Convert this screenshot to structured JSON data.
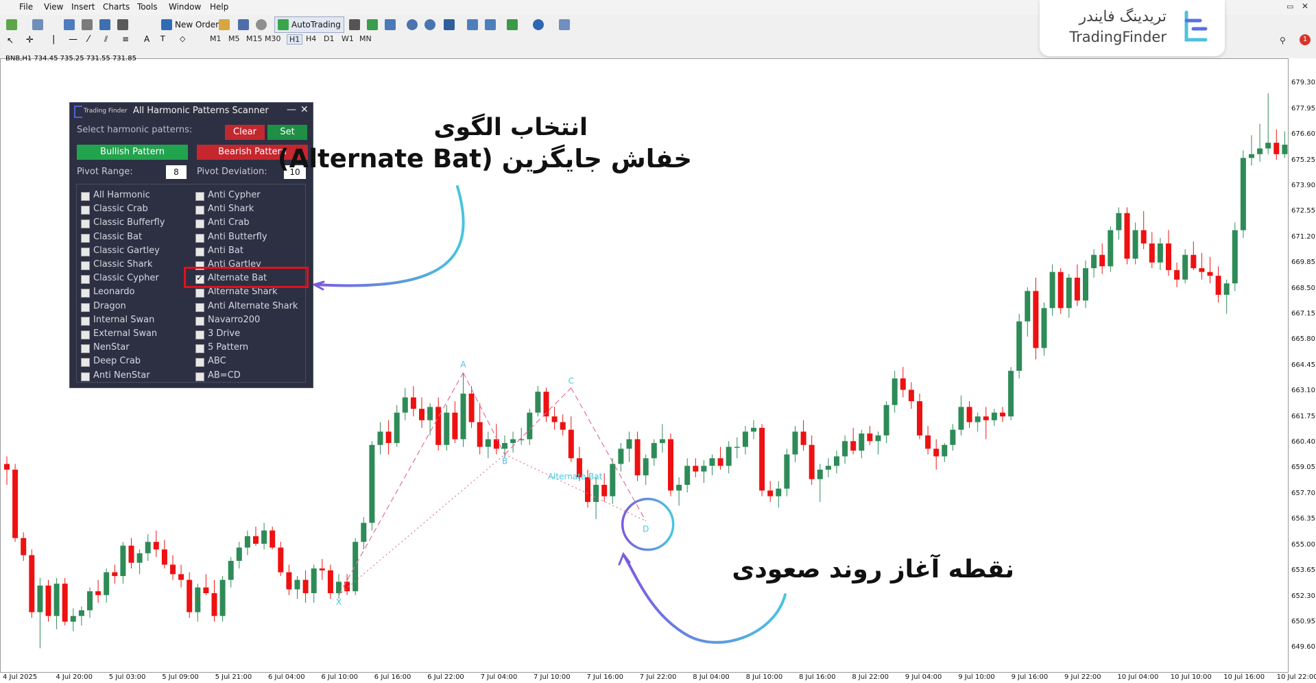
{
  "menu": [
    "File",
    "View",
    "Insert",
    "Charts",
    "Tools",
    "Window",
    "Help"
  ],
  "toolbar": {
    "new_order": "New Order",
    "autotrading": "AutoTrading"
  },
  "timeframes": [
    "M1",
    "M5",
    "M15",
    "M30",
    "H1",
    "H4",
    "D1",
    "W1",
    "MN"
  ],
  "logo": {
    "fa": "تریدینگ فایندر",
    "en": "TradingFinder"
  },
  "symbol_info": "BNB,H1  734.45 735.25 731.55 731.85",
  "panel": {
    "brand": "Trading Finder",
    "title": "All Harmonic Patterns Scanner",
    "minimize": "—",
    "close": "✕",
    "select_label": "Select harmonic patterns:",
    "clear": "Clear",
    "set": "Set",
    "bullish": "Bullish Pattern",
    "bearish": "Bearish Pattern",
    "pivot_range_label": "Pivot Range:",
    "pivot_range_value": "8",
    "pivot_deviation_label": "Pivot Deviation:",
    "pivot_deviation_value": "10",
    "left_items": [
      "All Harmonic",
      "Classic Crab",
      "Classic Bufferfly",
      "Classic Bat",
      "Classic Gartley",
      "Classic Shark",
      "Classic Cypher",
      "Leonardo",
      "Dragon",
      "Internal Swan",
      "External Swan",
      "NenStar",
      "Deep Crab",
      "Anti NenStar"
    ],
    "right_items": [
      "Anti Cypher",
      "Anti Shark",
      "Anti Crab",
      "Anti Butterfly",
      "Anti Bat",
      "Anti Gartley",
      "Alternate Bat",
      "Alternate Shark",
      "Anti Alternate Shark",
      "Navarro200",
      "3 Drive",
      "5 Pattern",
      "ABC",
      "AB=CD"
    ],
    "checked": "Alternate Bat"
  },
  "annotations": {
    "top_line1": "انتخاب الگوی",
    "top_line2": "خفاش جایگزین (Alternate Bat)",
    "bottom": "نقطه آغاز روند صعودی"
  },
  "pattern_labels": {
    "X": "X",
    "A": "A",
    "B": "B",
    "C": "C",
    "D": "D",
    "name": "Alternate Bat"
  },
  "price_axis": [
    "679.30",
    "677.95",
    "676.60",
    "675.25",
    "673.90",
    "672.55",
    "671.20",
    "669.85",
    "668.50",
    "667.15",
    "665.80",
    "664.45",
    "663.10",
    "661.75",
    "660.40",
    "659.05",
    "657.70",
    "656.35",
    "655.00",
    "653.65",
    "652.30",
    "650.95",
    "649.60"
  ],
  "time_axis": [
    "4 Jul 2025",
    "4 Jul 20:00",
    "5 Jul 03:00",
    "5 Jul 09:00",
    "5 Jul 21:00",
    "6 Jul 04:00",
    "6 Jul 10:00",
    "6 Jul 16:00",
    "6 Jul 22:00",
    "7 Jul 04:00",
    "7 Jul 10:00",
    "7 Jul 16:00",
    "7 Jul 22:00",
    "8 Jul 04:00",
    "8 Jul 10:00",
    "8 Jul 16:00",
    "8 Jul 22:00",
    "9 Jul 04:00",
    "9 Jul 10:00",
    "9 Jul 16:00",
    "9 Jul 22:00",
    "10 Jul 04:00",
    "10 Jul 10:00",
    "10 Jul 16:00",
    "10 Jul 22:00"
  ],
  "colors": {
    "bull": "#2e8b57",
    "bear": "#ee1111",
    "pattern": "#e0709a",
    "accent": "#47c6de",
    "arrow": "#7b5be0"
  },
  "chart_data": {
    "type": "candlestick",
    "symbol": "BNB,H1",
    "ylim": [
      649.0,
      680.5
    ],
    "candles": [
      [
        659.3,
        659.7,
        658.2,
        659.0
      ],
      [
        659.0,
        659.3,
        655.2,
        655.4
      ],
      [
        655.4,
        655.7,
        654.2,
        654.5
      ],
      [
        654.5,
        654.8,
        651.2,
        651.5
      ],
      [
        651.5,
        653.3,
        649.6,
        652.9
      ],
      [
        652.9,
        653.2,
        651.0,
        651.3
      ],
      [
        651.3,
        653.3,
        650.6,
        653.0
      ],
      [
        653.0,
        653.3,
        650.8,
        651.0
      ],
      [
        651.0,
        651.7,
        650.5,
        651.3
      ],
      [
        651.3,
        651.8,
        650.8,
        651.6
      ],
      [
        651.6,
        652.8,
        651.2,
        652.6
      ],
      [
        652.6,
        653.2,
        652.0,
        652.4
      ],
      [
        652.4,
        653.8,
        652.0,
        653.6
      ],
      [
        653.6,
        654.0,
        653.0,
        653.4
      ],
      [
        653.4,
        655.2,
        653.0,
        655.0
      ],
      [
        655.0,
        655.4,
        653.8,
        654.1
      ],
      [
        654.1,
        654.8,
        653.5,
        654.6
      ],
      [
        654.6,
        655.6,
        654.2,
        655.2
      ],
      [
        655.2,
        655.8,
        654.4,
        654.8
      ],
      [
        654.8,
        655.3,
        653.8,
        654.0
      ],
      [
        654.0,
        654.5,
        653.2,
        653.5
      ],
      [
        653.5,
        654.0,
        652.8,
        653.2
      ],
      [
        653.2,
        653.6,
        651.2,
        651.5
      ],
      [
        651.5,
        653.0,
        651.0,
        652.8
      ],
      [
        652.8,
        653.5,
        652.4,
        652.5
      ],
      [
        652.5,
        653.2,
        651.0,
        651.3
      ],
      [
        651.3,
        653.4,
        651.0,
        653.2
      ],
      [
        653.2,
        654.4,
        652.8,
        654.2
      ],
      [
        654.2,
        655.2,
        653.8,
        654.9
      ],
      [
        654.9,
        655.8,
        654.5,
        655.5
      ],
      [
        655.5,
        656.0,
        655.0,
        655.1
      ],
      [
        655.1,
        656.2,
        654.8,
        655.8
      ],
      [
        655.8,
        656.0,
        654.8,
        654.9
      ],
      [
        654.9,
        655.2,
        653.4,
        653.6
      ],
      [
        653.6,
        654.0,
        652.4,
        652.7
      ],
      [
        652.7,
        653.4,
        652.2,
        653.2
      ],
      [
        653.2,
        653.7,
        652.0,
        652.5
      ],
      [
        652.5,
        654.0,
        652.0,
        653.8
      ],
      [
        653.8,
        654.3,
        653.2,
        653.7
      ],
      [
        653.7,
        654.0,
        652.2,
        652.5
      ],
      [
        652.5,
        653.5,
        652.2,
        653.1
      ],
      [
        653.1,
        653.5,
        652.4,
        652.6
      ],
      [
        652.6,
        655.4,
        652.4,
        655.2
      ],
      [
        655.2,
        656.5,
        654.8,
        656.2
      ],
      [
        656.2,
        660.5,
        655.8,
        660.3
      ],
      [
        660.3,
        661.5,
        659.8,
        661.0
      ],
      [
        661.0,
        661.6,
        659.8,
        660.4
      ],
      [
        660.4,
        662.4,
        660.2,
        662.0
      ],
      [
        662.0,
        663.3,
        661.6,
        662.8
      ],
      [
        662.8,
        663.4,
        661.8,
        662.2
      ],
      [
        662.2,
        662.8,
        661.2,
        661.6
      ],
      [
        661.6,
        662.5,
        660.8,
        662.3
      ],
      [
        662.3,
        662.8,
        660.0,
        660.3
      ],
      [
        660.3,
        662.4,
        660.0,
        662.0
      ],
      [
        662.0,
        662.6,
        660.4,
        660.6
      ],
      [
        660.6,
        664.1,
        660.2,
        663.0
      ],
      [
        663.0,
        663.4,
        661.2,
        661.5
      ],
      [
        661.5,
        662.5,
        659.8,
        660.2
      ],
      [
        660.2,
        661.0,
        659.6,
        660.6
      ],
      [
        660.6,
        661.4,
        659.8,
        660.1
      ],
      [
        660.1,
        660.8,
        659.6,
        660.4
      ],
      [
        660.4,
        661.0,
        659.9,
        660.6
      ],
      [
        660.6,
        661.2,
        660.3,
        660.6
      ],
      [
        660.6,
        662.2,
        660.3,
        662.0
      ],
      [
        662.0,
        663.4,
        661.8,
        663.1
      ],
      [
        663.1,
        663.3,
        661.5,
        661.8
      ],
      [
        661.8,
        662.3,
        661.1,
        661.5
      ],
      [
        661.5,
        661.9,
        660.8,
        661.1
      ],
      [
        661.1,
        661.8,
        659.4,
        659.6
      ],
      [
        659.6,
        660.2,
        658.4,
        658.6
      ],
      [
        658.6,
        659.0,
        657.0,
        657.3
      ],
      [
        657.3,
        658.6,
        656.4,
        658.2
      ],
      [
        658.2,
        658.8,
        657.3,
        657.6
      ],
      [
        657.6,
        659.6,
        657.2,
        659.3
      ],
      [
        659.3,
        660.4,
        658.9,
        660.1
      ],
      [
        660.1,
        661.0,
        659.4,
        660.6
      ],
      [
        660.6,
        661.0,
        658.4,
        658.7
      ],
      [
        658.7,
        659.8,
        658.2,
        659.6
      ],
      [
        659.6,
        660.6,
        659.2,
        660.4
      ],
      [
        660.4,
        661.4,
        659.9,
        660.6
      ],
      [
        660.6,
        660.9,
        657.6,
        657.9
      ],
      [
        657.9,
        658.6,
        657.1,
        658.2
      ],
      [
        658.2,
        659.6,
        657.8,
        659.2
      ],
      [
        659.2,
        659.6,
        658.6,
        658.9
      ],
      [
        658.9,
        659.5,
        658.3,
        659.2
      ],
      [
        659.2,
        659.8,
        658.7,
        659.6
      ],
      [
        659.6,
        660.2,
        659.0,
        659.2
      ],
      [
        659.2,
        660.5,
        658.8,
        660.2
      ],
      [
        660.2,
        660.7,
        659.6,
        660.2
      ],
      [
        660.2,
        661.3,
        659.8,
        661.0
      ],
      [
        661.0,
        661.6,
        660.6,
        661.2
      ],
      [
        661.2,
        661.4,
        657.6,
        657.9
      ],
      [
        657.9,
        658.4,
        657.3,
        657.6
      ],
      [
        657.6,
        658.4,
        657.0,
        658.0
      ],
      [
        658.0,
        660.1,
        657.6,
        659.8
      ],
      [
        659.8,
        661.3,
        659.4,
        661.0
      ],
      [
        661.0,
        661.6,
        660.0,
        660.3
      ],
      [
        660.3,
        660.8,
        658.2,
        658.5
      ],
      [
        658.5,
        659.3,
        657.3,
        659.0
      ],
      [
        659.0,
        659.6,
        658.6,
        659.2
      ],
      [
        659.2,
        660.0,
        658.8,
        659.7
      ],
      [
        659.7,
        660.8,
        659.3,
        660.5
      ],
      [
        660.5,
        661.2,
        659.8,
        660.0
      ],
      [
        660.0,
        661.1,
        659.6,
        660.9
      ],
      [
        660.9,
        661.3,
        660.3,
        660.5
      ],
      [
        660.5,
        661.0,
        659.8,
        660.8
      ],
      [
        660.8,
        662.6,
        660.4,
        662.4
      ],
      [
        662.4,
        664.2,
        662.0,
        663.8
      ],
      [
        663.8,
        664.4,
        662.8,
        663.2
      ],
      [
        663.2,
        663.6,
        662.2,
        662.6
      ],
      [
        662.6,
        663.0,
        660.6,
        660.8
      ],
      [
        660.8,
        661.3,
        659.8,
        660.1
      ],
      [
        660.1,
        660.6,
        659.0,
        659.7
      ],
      [
        659.7,
        660.4,
        659.4,
        660.3
      ],
      [
        660.3,
        661.4,
        660.0,
        661.1
      ],
      [
        661.1,
        662.9,
        660.8,
        662.3
      ],
      [
        662.3,
        662.6,
        661.2,
        661.5
      ],
      [
        661.5,
        662.0,
        661.0,
        661.8
      ],
      [
        661.8,
        662.3,
        660.6,
        661.6
      ],
      [
        661.6,
        662.2,
        661.3,
        662.0
      ],
      [
        662.0,
        662.3,
        661.5,
        661.8
      ],
      [
        661.8,
        664.4,
        661.6,
        664.2
      ],
      [
        664.2,
        667.2,
        663.8,
        666.8
      ],
      [
        666.8,
        668.6,
        666.0,
        668.4
      ],
      [
        668.4,
        669.1,
        664.8,
        665.4
      ],
      [
        665.4,
        667.8,
        665.0,
        667.5
      ],
      [
        667.5,
        669.8,
        667.1,
        669.4
      ],
      [
        669.4,
        669.6,
        667.2,
        667.5
      ],
      [
        667.5,
        669.3,
        667.0,
        669.1
      ],
      [
        669.1,
        669.8,
        667.6,
        667.9
      ],
      [
        667.9,
        670.0,
        667.5,
        669.6
      ],
      [
        669.6,
        670.6,
        669.1,
        670.3
      ],
      [
        670.3,
        670.9,
        669.3,
        669.7
      ],
      [
        669.7,
        671.8,
        669.4,
        671.6
      ],
      [
        671.6,
        672.8,
        671.1,
        672.5
      ],
      [
        672.5,
        672.8,
        669.8,
        670.1
      ],
      [
        670.1,
        672.0,
        669.8,
        671.6
      ],
      [
        671.6,
        672.6,
        670.6,
        670.9
      ],
      [
        670.9,
        671.5,
        669.6,
        669.9
      ],
      [
        669.9,
        671.2,
        669.5,
        670.9
      ],
      [
        670.9,
        671.6,
        669.2,
        669.5
      ],
      [
        669.5,
        669.9,
        668.6,
        669.0
      ],
      [
        669.0,
        670.6,
        668.8,
        670.3
      ],
      [
        670.3,
        671.0,
        669.5,
        669.6
      ],
      [
        669.6,
        670.4,
        669.0,
        669.4
      ],
      [
        669.4,
        670.2,
        668.8,
        669.2
      ],
      [
        669.2,
        669.7,
        667.8,
        668.2
      ],
      [
        668.2,
        669.0,
        667.2,
        668.8
      ],
      [
        668.8,
        672.0,
        668.4,
        671.6
      ],
      [
        671.6,
        675.8,
        671.2,
        675.4
      ],
      [
        675.4,
        676.6,
        675.0,
        675.6
      ],
      [
        675.6,
        677.2,
        675.2,
        675.9
      ],
      [
        675.9,
        678.8,
        675.6,
        676.2
      ],
      [
        676.2,
        676.9,
        675.3,
        675.6
      ],
      [
        675.6,
        676.8,
        675.4,
        676.1
      ]
    ],
    "pattern": {
      "name": "Alternate Bat",
      "points": [
        [
          "X",
          40,
          652.4
        ],
        [
          "A",
          55,
          664.1
        ],
        [
          "B",
          60,
          659.8
        ],
        [
          "C",
          68,
          663.3
        ],
        [
          "D",
          77,
          656.3
        ]
      ]
    }
  }
}
